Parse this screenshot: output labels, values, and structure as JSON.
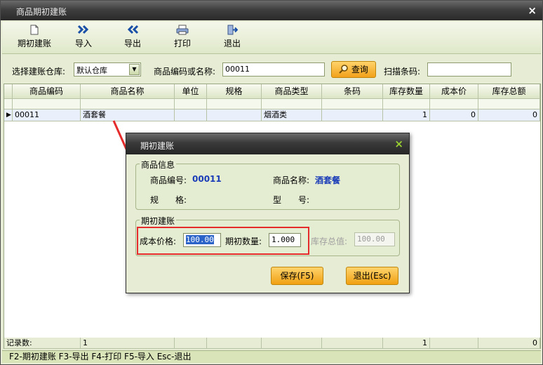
{
  "window": {
    "title": "商品期初建账",
    "close_glyph": "×"
  },
  "toolbar": {
    "items": [
      {
        "label": "期初建账",
        "icon": "document-icon"
      },
      {
        "label": "导入",
        "icon": "double-chevron-right-icon"
      },
      {
        "label": "导出",
        "icon": "double-chevron-left-icon"
      },
      {
        "label": "打印",
        "icon": "printer-icon"
      },
      {
        "label": "退出",
        "icon": "exit-door-icon"
      }
    ]
  },
  "filter": {
    "warehouse_label": "选择建账仓库:",
    "warehouse_value": "默认仓库",
    "code_label": "商品编码或名称:",
    "code_value": "00011",
    "query_label": "查询",
    "scan_label": "扫描条码:",
    "scan_value": ""
  },
  "table": {
    "columns": [
      "商品编码",
      "商品名称",
      "单位",
      "规格",
      "商品类型",
      "条码",
      "库存数量",
      "成本价",
      "库存总额"
    ],
    "rows": [
      {
        "code": "00011",
        "name": "酒套餐",
        "unit": "",
        "spec": "",
        "type": "烟酒类",
        "barcode": "",
        "qty": "1",
        "cost": "0",
        "total": "0"
      }
    ],
    "footer": {
      "label": "记录数:",
      "count": "1",
      "qty": "1",
      "total": "0"
    }
  },
  "status_bar": "F2-期初建账 F3-导出 F4-打印 F5-导入 Esc-退出",
  "dialog": {
    "title": "期初建账",
    "close_glyph": "×",
    "info_group": "商品信息",
    "code_label": "商品编号:",
    "code_value": "00011",
    "name_label": "商品名称:",
    "name_value": "酒套餐",
    "spec_label": "规　　格:",
    "model_label": "型　　号:",
    "setup_group": "期初建账",
    "cost_label": "成本价格:",
    "cost_value": "100.00",
    "qty_label": "期初数量:",
    "qty_value": "1.000",
    "total_label": "库存总值:",
    "total_value": "100.00",
    "save_label": "保存(F5)",
    "exit_label": "退出(Esc)"
  },
  "colors": {
    "accent": "#f2a11a",
    "highlight_box": "#e52b2b",
    "value_text": "#1a3cb8"
  }
}
